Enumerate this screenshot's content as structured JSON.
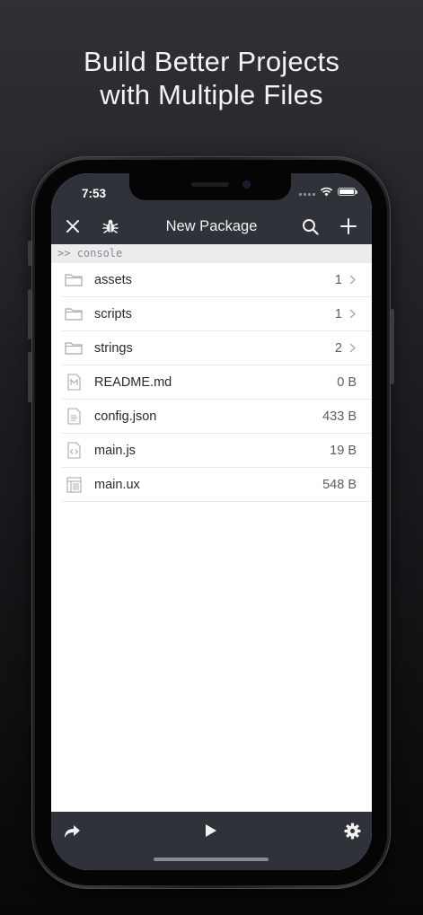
{
  "headline": {
    "line1": "Build Better Projects",
    "line2": "with Multiple Files"
  },
  "status_bar": {
    "time": "7:53",
    "icons": [
      "signal-icon",
      "wifi-icon",
      "battery-icon"
    ]
  },
  "nav": {
    "title": "New Package",
    "left_icons": [
      "close-icon",
      "bug-icon"
    ],
    "right_icons": [
      "search-icon",
      "plus-icon"
    ]
  },
  "console": {
    "prompt": ">>",
    "label": "console"
  },
  "files": [
    {
      "name": "assets",
      "meta": "1",
      "icon": "folder-icon",
      "chevron": true
    },
    {
      "name": "scripts",
      "meta": "1",
      "icon": "folder-icon",
      "chevron": true
    },
    {
      "name": "strings",
      "meta": "2",
      "icon": "folder-icon",
      "chevron": true
    },
    {
      "name": "README.md",
      "meta": "0 B",
      "icon": "markdown-file-icon",
      "chevron": false
    },
    {
      "name": "config.json",
      "meta": "433 B",
      "icon": "text-file-icon",
      "chevron": false
    },
    {
      "name": "main.js",
      "meta": "19 B",
      "icon": "code-file-icon",
      "chevron": false
    },
    {
      "name": "main.ux",
      "meta": "548 B",
      "icon": "layout-file-icon",
      "chevron": false
    }
  ],
  "bottom_bar": {
    "icons": [
      "share-icon",
      "play-icon",
      "gear-icon"
    ]
  },
  "colors": {
    "bar": "#2f3238",
    "console_bg": "#ececee",
    "icon_gray": "#a9a9ae"
  }
}
